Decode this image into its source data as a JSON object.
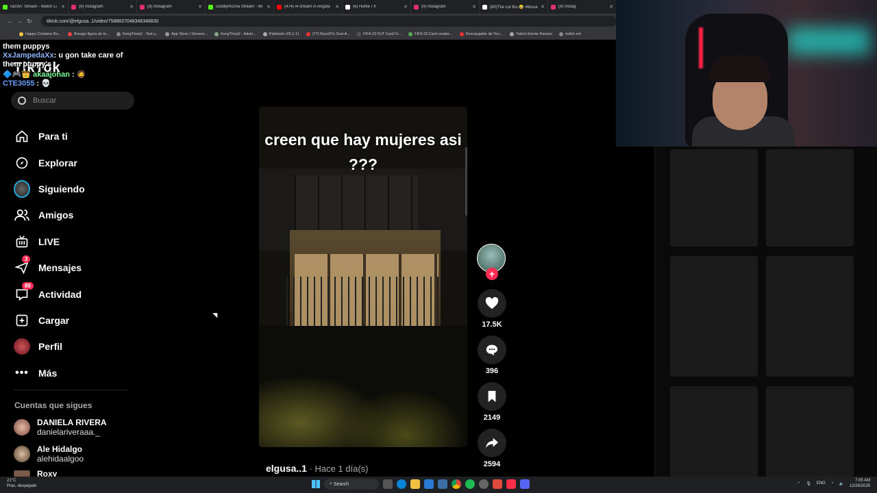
{
  "browser": {
    "tabs": [
      {
        "title": "razo97 Stream - Watch Li",
        "color": "#53fc18"
      },
      {
        "title": "(9) Instagram",
        "color": "#e1306c"
      },
      {
        "title": "(9) Instagram",
        "color": "#e1306c"
      },
      {
        "title": "cuddlymcsna Stream - Wi",
        "color": "#53fc18"
      },
      {
        "title": "(474) i4 stream in Angola",
        "color": "#ff0000"
      },
      {
        "title": "(6) Home / X",
        "color": "#ffffff"
      },
      {
        "title": "(9) Instagram",
        "color": "#e1306c"
      },
      {
        "title": "(80)The cut tho 😂 #bruce",
        "color": "#ffffff"
      },
      {
        "title": "(9) Instag",
        "color": "#e1306c"
      }
    ],
    "url": "tiktok.com/@elgusa..1/video/7588837048346348830",
    "bookmarks": [
      "Happy Cristiano Ro...",
      "Burago figura de to...",
      "SongTrivia2 - Test y...",
      "App Store / Streami...",
      "SongTrivia2 - Advin...",
      "Paletoob v25.1.11",
      "(77) Razo97s Zest-A...",
      "FIFA 23 FUT Card Cr...",
      "FIFA 23 Card creator...",
      "Descargador de You...",
      "Twitch Emote Resizer",
      "twitch em"
    ]
  },
  "chat": {
    "line1": "them puppys",
    "user1": "XxJampedaXx",
    "msg1": ": u gon take care of them puppy's",
    "user2": "akaajohan",
    "msg2": ":",
    "user3": "CTE3055",
    "msg3": ":"
  },
  "tiktok": {
    "logo": "TikTok",
    "search_placeholder": "Buscar",
    "nav": [
      {
        "label": "Para ti",
        "icon": "home-icon"
      },
      {
        "label": "Explorar",
        "icon": "compass-icon"
      },
      {
        "label": "Siguiendo",
        "icon": "following-avatar-icon"
      },
      {
        "label": "Amigos",
        "icon": "friends-icon"
      },
      {
        "label": "LIVE",
        "icon": "live-tv-icon"
      },
      {
        "label": "Mensajes",
        "icon": "paper-plane-icon",
        "badge": "3"
      },
      {
        "label": "Actividad",
        "icon": "inbox-icon",
        "badge": "86"
      },
      {
        "label": "Cargar",
        "icon": "upload-plus-icon"
      },
      {
        "label": "Perfil",
        "icon": "profile-avatar-icon"
      },
      {
        "label": "Más",
        "icon": "more-dots-icon"
      }
    ],
    "following_header": "Cuentas que sigues",
    "following": [
      {
        "name": "DANIELA RIVERA",
        "handle": "danielariveraaa._"
      },
      {
        "name": "Ale Hidalgo",
        "handle": "alehidaalgoo"
      },
      {
        "name": "Roxy",
        "handle": ""
      }
    ],
    "video": {
      "caption": "creen que hay mujeres asi ???",
      "author": "elgusa..1",
      "time": " · Hace 1 día(s)",
      "likes": "17.5K",
      "comments": "396",
      "saves": "2149",
      "shares": "2594"
    }
  },
  "taskbar": {
    "temp": "21°C",
    "weather": "Prac. despejado",
    "search": "Search",
    "lang": "ENG",
    "time": "7:05 AM",
    "date": "12/28/2025"
  },
  "colors": {
    "accent": "#fe2c55"
  }
}
